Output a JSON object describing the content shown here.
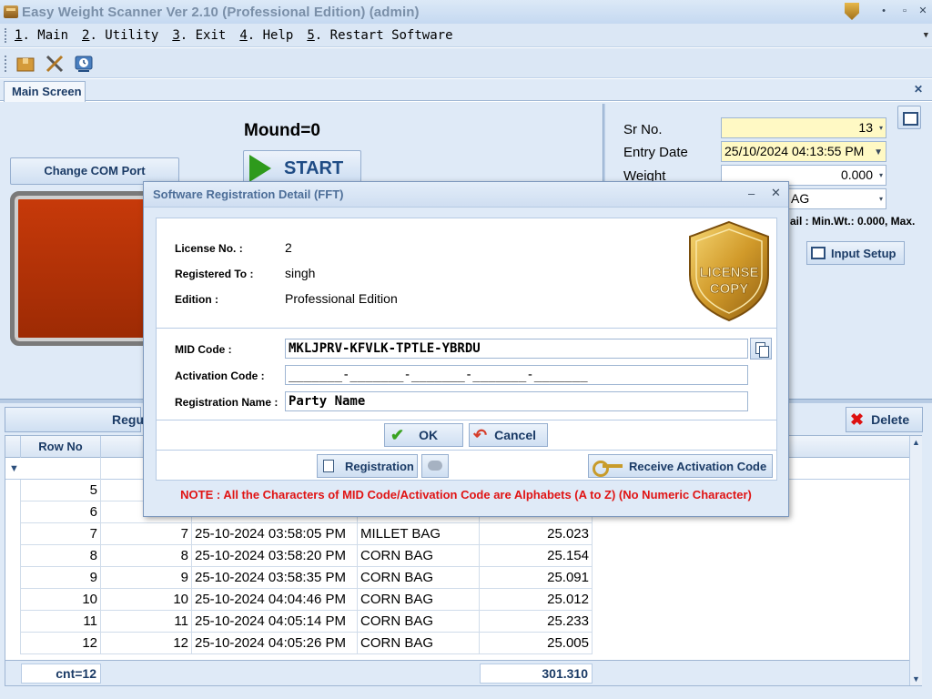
{
  "window": {
    "title": "Easy Weight Scanner Ver 2.10 (Professional Edition) (admin)",
    "controls": [
      "•",
      "▫",
      "✕"
    ]
  },
  "menu": [
    {
      "key": "1",
      "label": ". Main"
    },
    {
      "key": "2",
      "label": ". Utility"
    },
    {
      "key": "3",
      "label": ". Exit"
    },
    {
      "key": "4",
      "label": ". Help"
    },
    {
      "key": "5",
      "label": ". Restart Software"
    }
  ],
  "toolbar": {
    "icons": [
      "box-icon",
      "tools-icon",
      "history-icon"
    ]
  },
  "tabs": {
    "active": "Main Screen",
    "close": "✕"
  },
  "main": {
    "change_com_port": "Change COM Port",
    "mound": "Mound=0",
    "start": "START",
    "sr_no_label": "Sr No.",
    "sr_no_value": "13",
    "entry_date_label": "Entry Date",
    "entry_date_value": "25/10/2024 04:13:55 PM",
    "weight_label": "Weight",
    "weight_value": "0.000",
    "item_value": "AG",
    "minwt_text": "ail : Min.Wt.: 0.000, Max.",
    "input_setup": "Input Setup"
  },
  "grid": {
    "register_button": "Regu",
    "delete_button": "Delete",
    "headers": [
      "Row No"
    ],
    "rows": [
      {
        "row_no": "5",
        "sr": "",
        "date": "",
        "item": "",
        "weight": ""
      },
      {
        "row_no": "6",
        "sr": "",
        "date": "",
        "item": "",
        "weight": ""
      },
      {
        "row_no": "7",
        "sr": "7",
        "date": "25-10-2024 03:58:05 PM",
        "item": "MILLET BAG",
        "weight": "25.023"
      },
      {
        "row_no": "8",
        "sr": "8",
        "date": "25-10-2024 03:58:20 PM",
        "item": "CORN BAG",
        "weight": "25.154"
      },
      {
        "row_no": "9",
        "sr": "9",
        "date": "25-10-2024 03:58:35 PM",
        "item": "CORN BAG",
        "weight": "25.091"
      },
      {
        "row_no": "10",
        "sr": "10",
        "date": "25-10-2024 04:04:46 PM",
        "item": "CORN BAG",
        "weight": "25.012"
      },
      {
        "row_no": "11",
        "sr": "11",
        "date": "25-10-2024 04:05:14 PM",
        "item": "CORN BAG",
        "weight": "25.233"
      },
      {
        "row_no": "12",
        "sr": "12",
        "date": "25-10-2024 04:05:26 PM",
        "item": "CORN BAG",
        "weight": "25.005"
      }
    ],
    "footer_count": "cnt=12",
    "footer_total": "301.310"
  },
  "modal": {
    "title": "Software Registration Detail (FFT)",
    "license_no_label": "License No. :",
    "license_no_value": "2",
    "registered_to_label": "Registered To :",
    "registered_to_value": "singh",
    "edition_label": "Edition :",
    "edition_value": "Professional Edition",
    "badge_text_1": "LICENSE",
    "badge_text_2": "COPY",
    "mid_code_label": "MID Code :",
    "mid_code_value": "MKLJPRV-KFVLK-TPTLE-YBRDU",
    "activation_code_label": "Activation Code :",
    "activation_code_value": "_______-_______-_______-_______-_______",
    "registration_name_label": "Registration Name :",
    "registration_name_value": "Party Name",
    "ok": "OK",
    "cancel": "Cancel",
    "registration": "Registration",
    "receive_activation_code": "Receive Activation Code",
    "note": "NOTE : All the Characters of MID Code/Activation Code are Alphabets (A to Z) (No Numeric Character)"
  }
}
